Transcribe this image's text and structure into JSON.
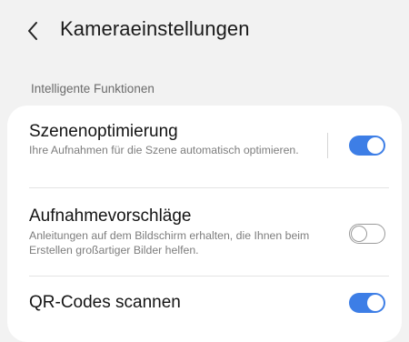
{
  "header": {
    "back_icon": "chevron-left-icon",
    "title": "Kameraeinstellungen"
  },
  "section": {
    "label": "Intelligente Funktionen"
  },
  "settings": [
    {
      "title": "Szenenoptimierung",
      "description": "Ihre Aufnahmen für die Szene automatisch optimieren.",
      "enabled": true
    },
    {
      "title": "Aufnahmevorschläge",
      "description": "Anleitungen auf dem Bildschirm erhalten, die Ihnen beim Erstellen großartiger Bilder helfen.",
      "enabled": false
    },
    {
      "title": "QR-Codes scannen",
      "description": "",
      "enabled": true
    }
  ],
  "colors": {
    "accent": "#3d7ee6",
    "background": "#f2f2f2",
    "card": "#ffffff"
  }
}
